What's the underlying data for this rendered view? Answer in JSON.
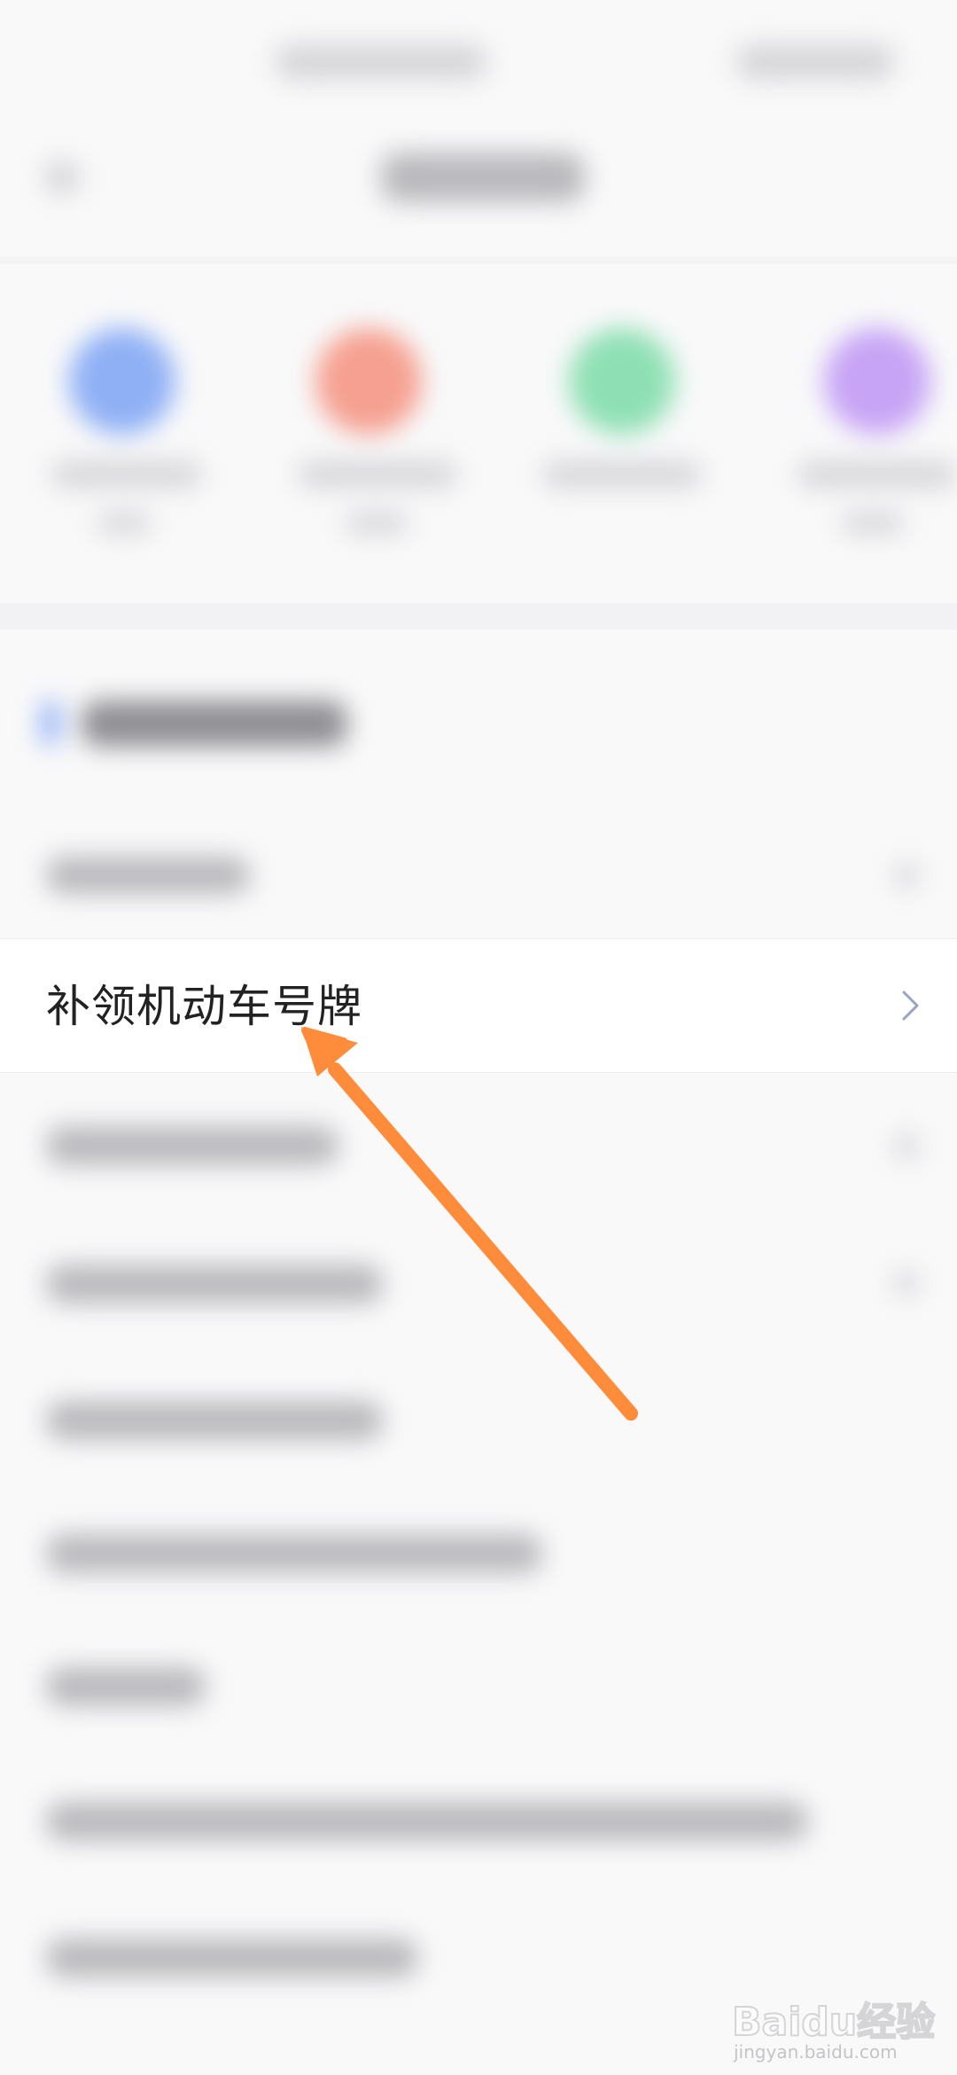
{
  "list": {
    "highlighted_item": {
      "label": "补领机动车号牌"
    }
  },
  "watermark": {
    "brand": "Baidu经验",
    "site": "jingyan.baidu.com"
  },
  "colors": {
    "arrow": "#ff8c3a",
    "chevron": "#9aa3c2",
    "icon_blue": "#8fb0f5",
    "icon_red": "#f5a090",
    "icon_green": "#8ee0b4",
    "icon_purple": "#c7a4f5",
    "section_accent": "#7fa2f5"
  },
  "icons": {
    "chevron": "chevron-right-icon",
    "arrow": "orange-arrow-annotation"
  }
}
